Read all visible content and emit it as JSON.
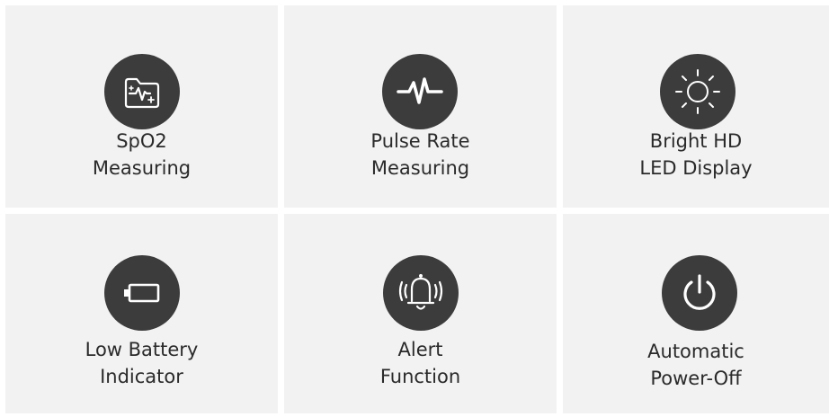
{
  "features": [
    {
      "line1": "SpO2",
      "line2": "Measuring",
      "icon": "folder-heartbeat-icon"
    },
    {
      "line1": "Pulse Rate",
      "line2": "Measuring",
      "icon": "pulse-wave-icon"
    },
    {
      "line1": "Bright HD",
      "line2": "LED Display",
      "icon": "sun-icon"
    },
    {
      "line1": "Low Battery",
      "line2": "Indicator",
      "icon": "battery-low-icon"
    },
    {
      "line1": "Alert",
      "line2": "Function",
      "icon": "bell-alert-icon"
    },
    {
      "line1": "Automatic",
      "line2": "Power-Off",
      "icon": "power-icon"
    }
  ],
  "colors": {
    "tile_background": "#f2f2f2",
    "icon_circle": "#3c3c3c",
    "icon_stroke": "#ffffff",
    "text": "#2a2a2a"
  }
}
